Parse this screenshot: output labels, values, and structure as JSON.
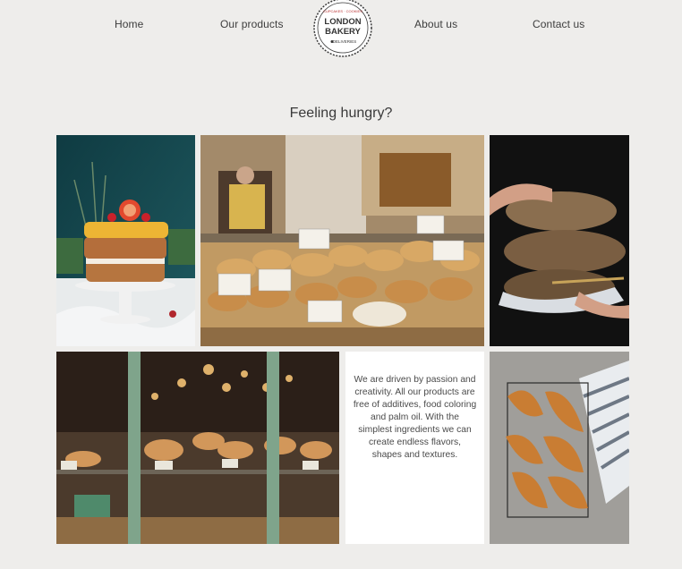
{
  "nav": {
    "home": "Home",
    "products": "Our products",
    "about": "About us",
    "contact": "Contact us"
  },
  "logo": {
    "line1": "LONDON",
    "line2": "BAKERY",
    "arc_top": "CUPCAKES · COOKIES",
    "arc_bottom": "DELIVERIES"
  },
  "main": {
    "headline": "Feeling hungry?",
    "about_text": "We are driven by passion and creativity. All our products are free of additives, food coloring and palm oil. With the simplest ingredients we can create endless flavors, shapes and textures."
  },
  "gallery": [
    {
      "image": "layered-cake-photo"
    },
    {
      "image": "bread-stall-photo"
    },
    {
      "image": "bread-loaves-photo"
    },
    {
      "image": "bakery-window-photo"
    },
    {
      "image": "croissants-photo"
    }
  ]
}
